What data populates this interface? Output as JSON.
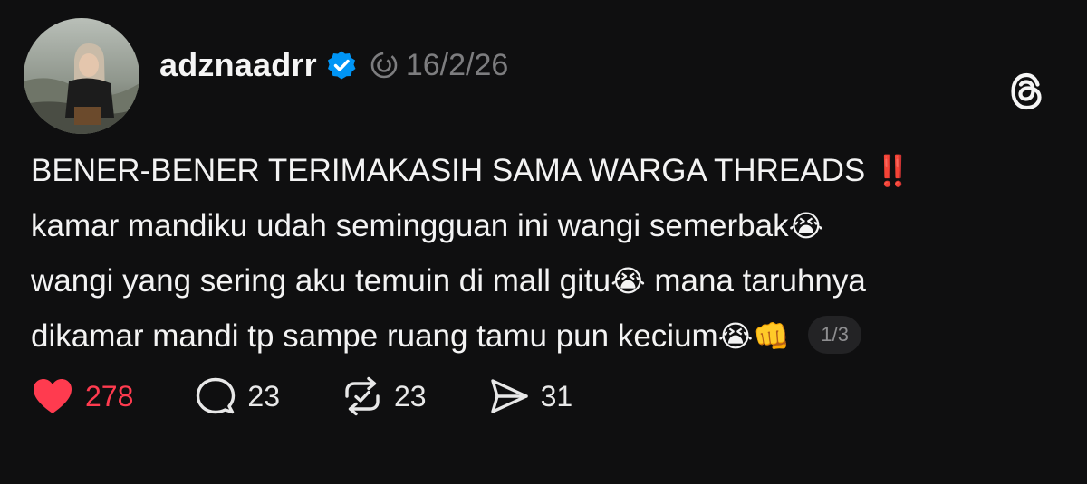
{
  "post": {
    "username": "adznaadrr",
    "timestamp": "16/2/26",
    "lines": [
      "BENER-BENER TERIMAKASIH SAMA WARGA THREADS",
      "kamar mandiku udah seminggu­an ini wangi semerbak",
      "wangi yang sering aku temuin di mall gitu",
      "mana taruhnya",
      "dikamar mandi tp sampe ruang tamu pun kecium"
    ],
    "emojis": {
      "exclamation": "‼️",
      "crying": "😭",
      "fist": "👊"
    },
    "pager": "1/3"
  },
  "actions": {
    "likes": "278",
    "replies": "23",
    "reposts": "23",
    "shares": "31"
  },
  "colors": {
    "background": "#0f0f10",
    "like": "#ff3b4f",
    "verified": "#0095f6",
    "muted": "#7d7d7f"
  }
}
